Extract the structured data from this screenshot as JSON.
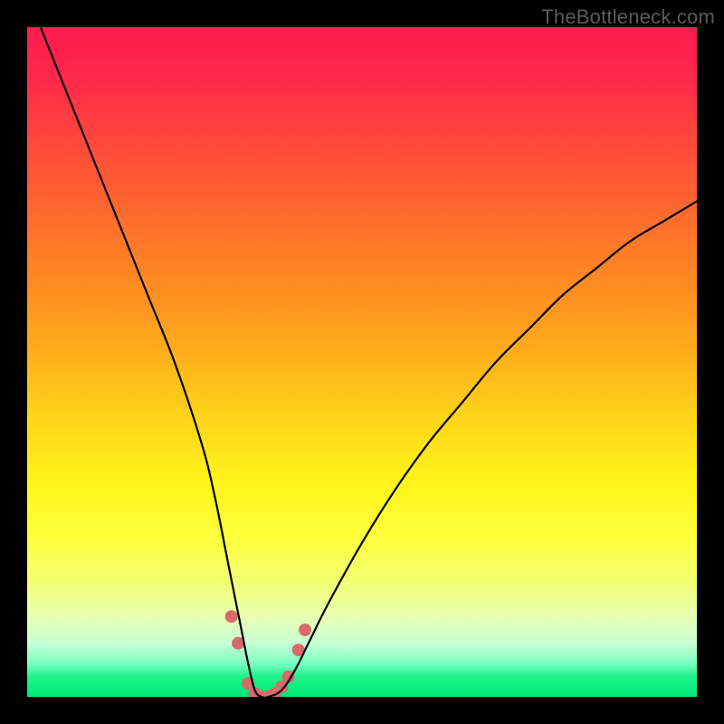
{
  "watermark": "TheBottleneck.com",
  "chart_data": {
    "type": "line",
    "title": "",
    "xlabel": "",
    "ylabel": "",
    "xlim": [
      0,
      100
    ],
    "ylim": [
      0,
      100
    ],
    "series": [
      {
        "name": "bottleneck-curve",
        "x": [
          2,
          6,
          10,
          14,
          18,
          22,
          26,
          28,
          30,
          32,
          33,
          34,
          35,
          36,
          38,
          40,
          42,
          45,
          50,
          55,
          60,
          65,
          70,
          75,
          80,
          85,
          90,
          95,
          100
        ],
        "values": [
          100,
          90,
          80,
          70,
          60,
          50,
          38,
          30,
          20,
          10,
          5,
          1,
          0,
          0,
          1,
          4,
          8,
          14,
          23,
          31,
          38,
          44,
          50,
          55,
          60,
          64,
          68,
          71,
          74
        ]
      }
    ],
    "markers": {
      "name": "highlight-dots",
      "x": [
        30.5,
        31.5,
        33,
        34,
        35,
        36,
        37,
        38,
        39,
        40.5,
        41.5
      ],
      "values": [
        12,
        8,
        2,
        0.5,
        0,
        0,
        0.5,
        1.5,
        3,
        7,
        10
      ],
      "color": "#d86a6a",
      "size": 14
    },
    "gradient_stops": [
      {
        "pos": 0,
        "color": "#ff1a50"
      },
      {
        "pos": 50,
        "color": "#ffd319"
      },
      {
        "pos": 80,
        "color": "#fdff3a"
      },
      {
        "pos": 100,
        "color": "#00e676"
      }
    ]
  }
}
